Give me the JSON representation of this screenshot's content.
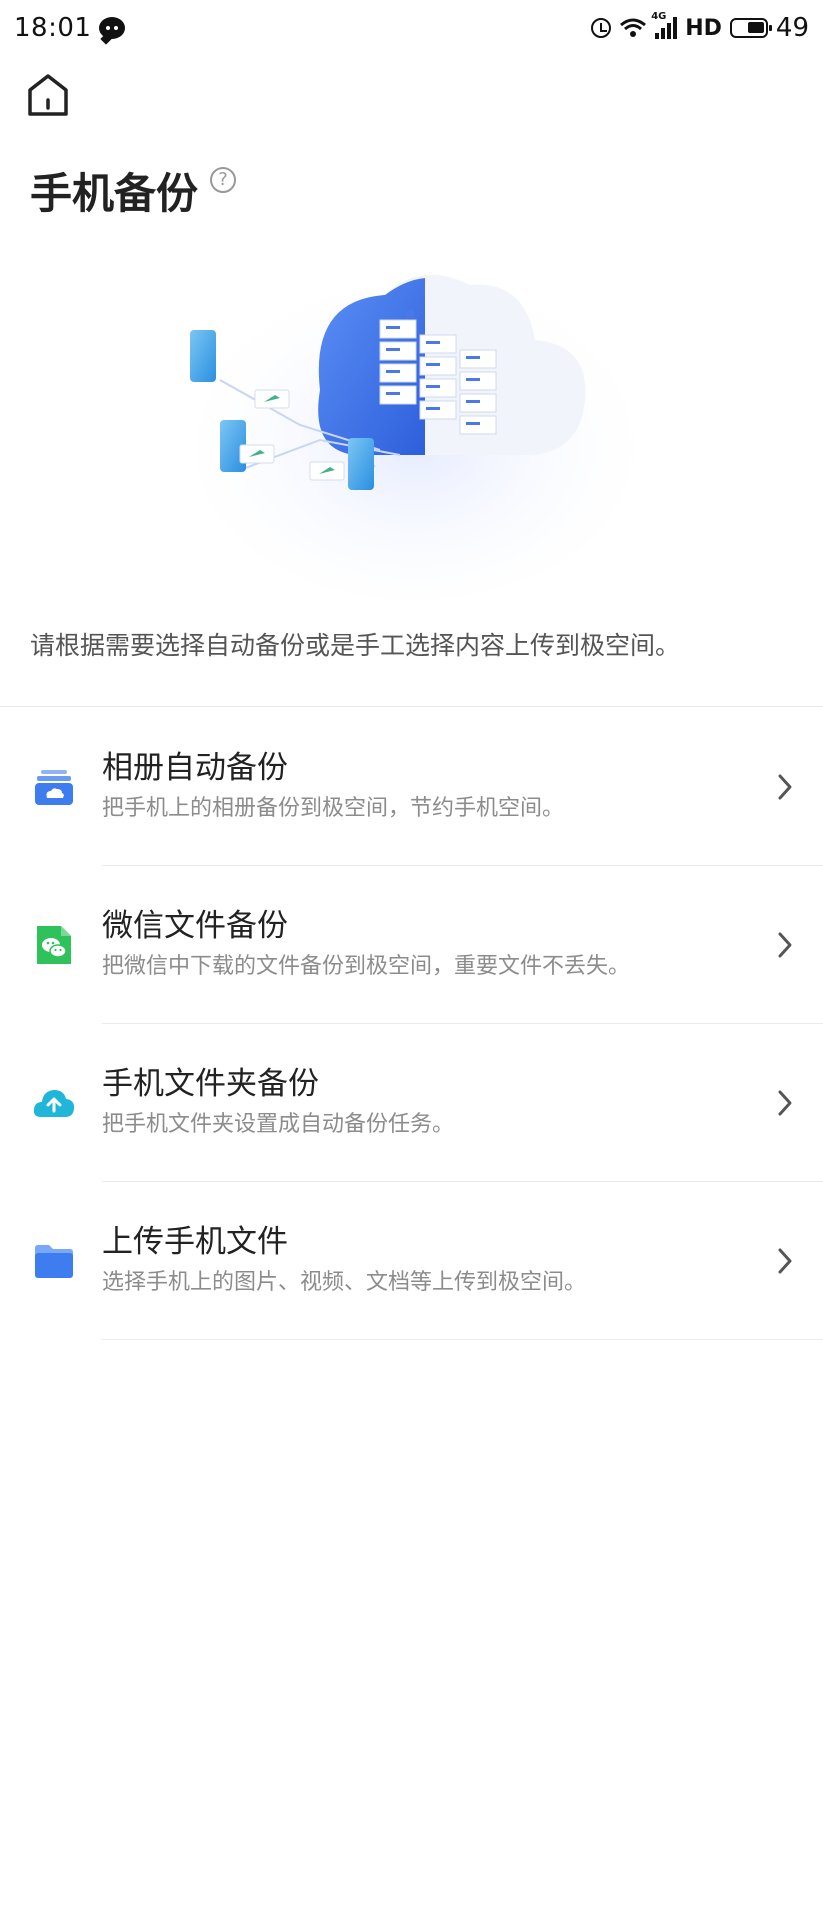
{
  "status_bar": {
    "time": "18:01",
    "network_tag": "4G",
    "hd": "HD",
    "battery": "49"
  },
  "header": {
    "title": "手机备份",
    "help_symbol": "?"
  },
  "intro": "请根据需要选择自动备份或是手工选择内容上传到极空间。",
  "options": [
    {
      "title": "相册自动备份",
      "desc": "把手机上的相册备份到极空间，节约手机空间。",
      "icon": "album-backup-icon"
    },
    {
      "title": "微信文件备份",
      "desc": "把微信中下载的文件备份到极空间，重要文件不丢失。",
      "icon": "wechat-icon"
    },
    {
      "title": "手机文件夹备份",
      "desc": "把手机文件夹设置成自动备份任务。",
      "icon": "cloud-upload-icon"
    },
    {
      "title": "上传手机文件",
      "desc": "选择手机上的图片、视频、文档等上传到极空间。",
      "icon": "folder-icon"
    }
  ],
  "colors": {
    "accent_blue": "#3d7df0",
    "wechat_green": "#2fc25b",
    "cloud_cyan": "#1fb6d9",
    "text_secondary": "#8c8c8c"
  }
}
